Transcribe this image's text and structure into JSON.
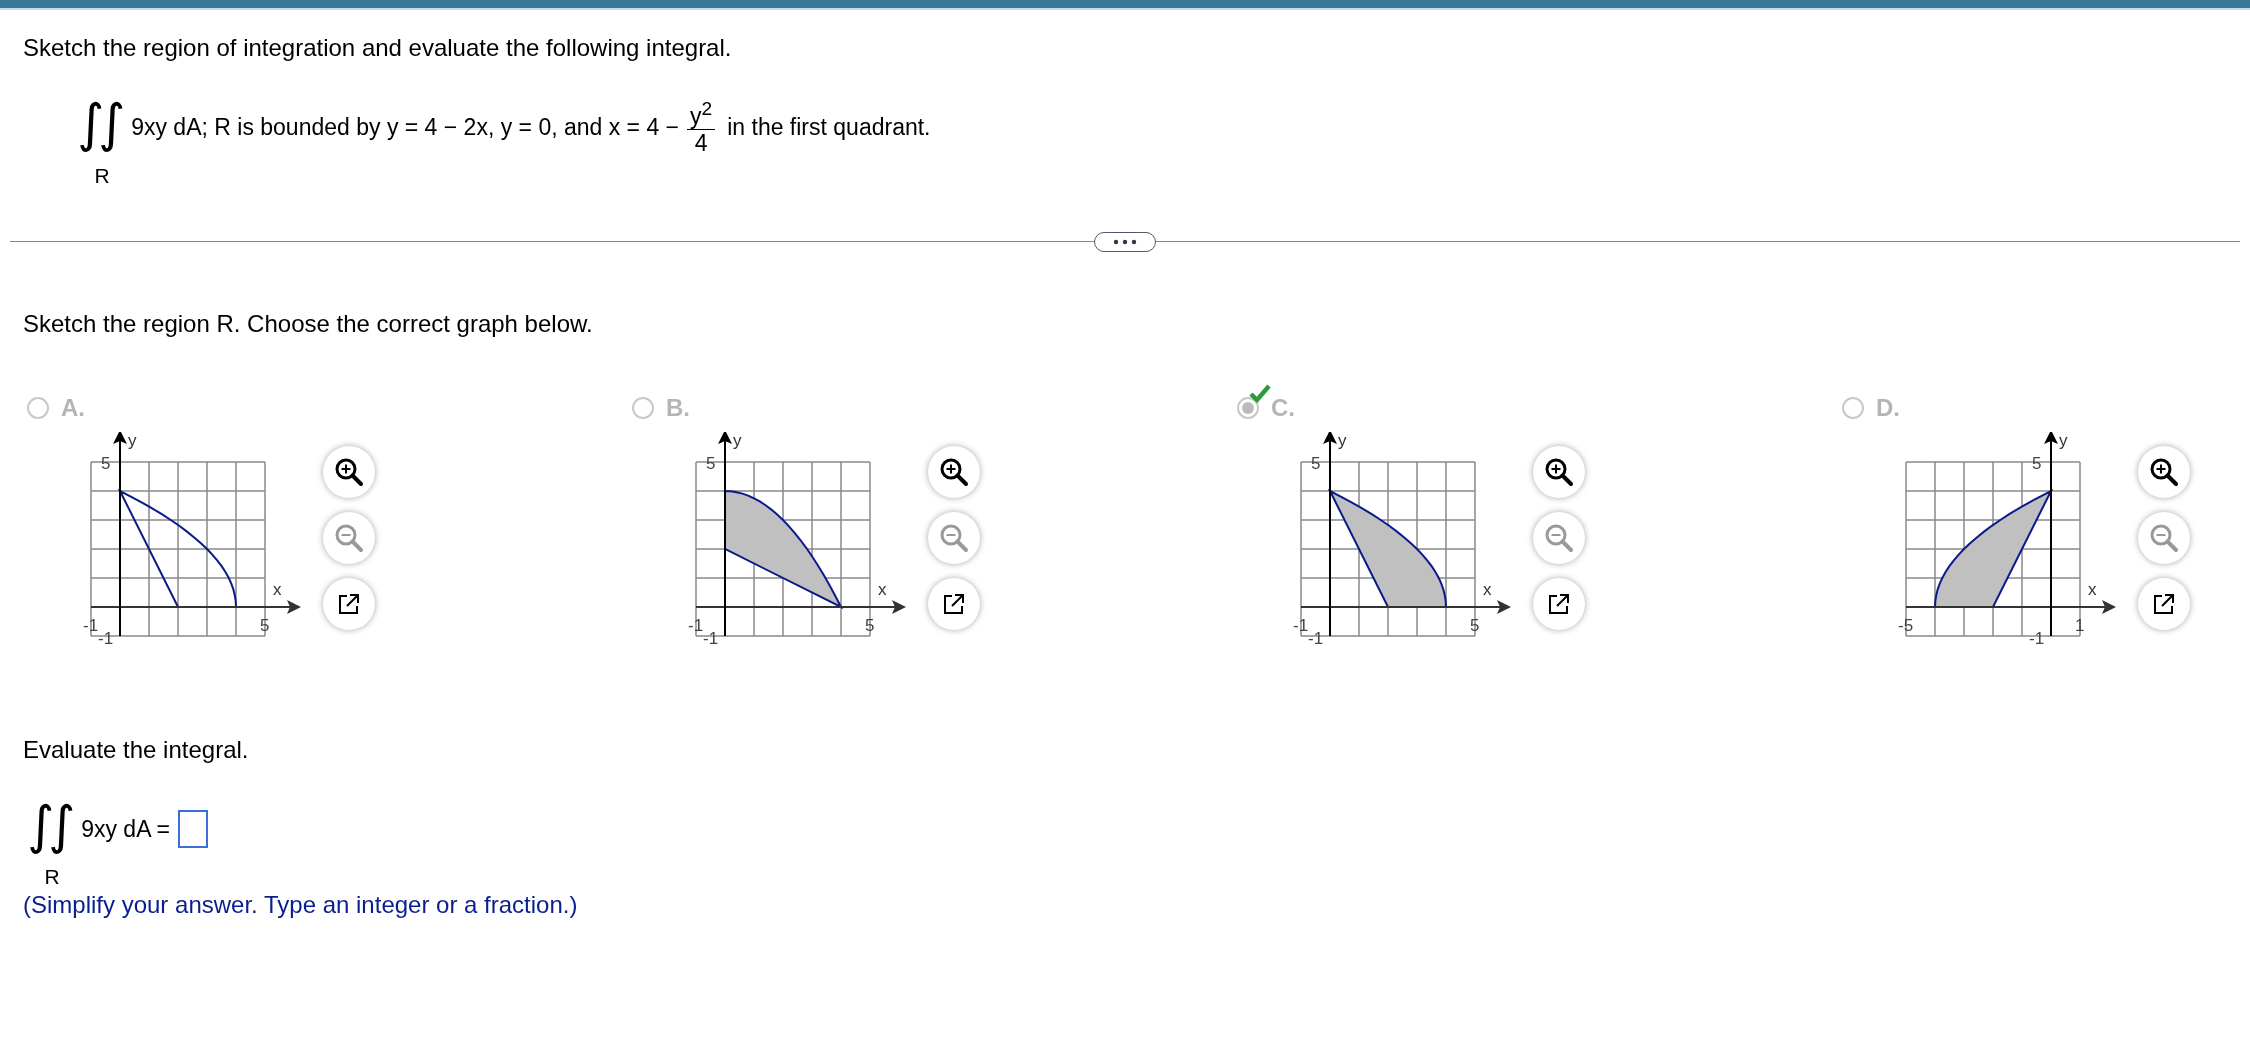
{
  "instruction": "Sketch the region of integration and evaluate the following integral.",
  "problem": {
    "integral_sign": "∫∫",
    "region": "R",
    "text": "9xy dA; R is bounded by y = 4 − 2x, y = 0, and x = 4 −",
    "numerator": "y$^{2}$",
    "denominator": "4",
    "tail": "in the first quadrant."
  },
  "part1": {
    "prompt": "Sketch the region R. Choose the correct graph below.",
    "options": [
      {
        "letter": "A.",
        "selected": false,
        "correct": false,
        "zoom_out_disabled": true,
        "graph": {
          "kind": "right-fan",
          "shaded": false,
          "x_min": "-1",
          "x_max": "5",
          "y_min": "-1",
          "y_max": "5",
          "x_label": "x",
          "y_label": "y"
        }
      },
      {
        "letter": "B.",
        "selected": false,
        "correct": false,
        "zoom_out_disabled": true,
        "graph": {
          "kind": "top-wedge",
          "shaded": true,
          "x_min": "-1",
          "x_max": "5",
          "y_min": "-1",
          "y_max": "5",
          "x_label": "x",
          "y_label": "y"
        }
      },
      {
        "letter": "C.",
        "selected": true,
        "correct": true,
        "zoom_out_disabled": true,
        "graph": {
          "kind": "right-fan",
          "shaded": true,
          "x_min": "-1",
          "x_max": "5",
          "y_min": "-1",
          "y_max": "5",
          "x_label": "x",
          "y_label": "y"
        }
      },
      {
        "letter": "D.",
        "selected": false,
        "correct": false,
        "zoom_out_disabled": true,
        "graph": {
          "kind": "left-fan",
          "shaded": true,
          "x_min": "-5",
          "x_max": "1",
          "y_min": "-1",
          "y_max": "5",
          "x_label": "x",
          "y_label": "y"
        }
      }
    ]
  },
  "part2": {
    "prompt": "Evaluate the integral.",
    "integral_sign": "∫∫",
    "region": "R",
    "expression": "9xy dA =",
    "hint": "(Simplify your answer. Type an integer or a fraction.)"
  }
}
